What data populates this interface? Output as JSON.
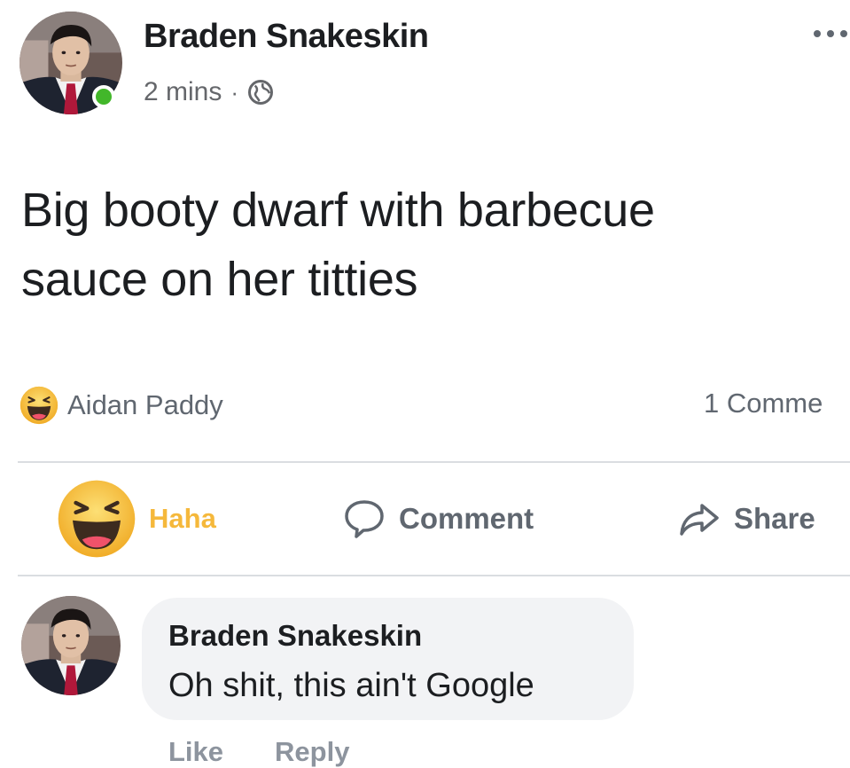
{
  "post": {
    "author": "Braden Snakeskin",
    "time": "2 mins",
    "separator": "·",
    "privacy_icon": "globe-icon",
    "more_icon": "more-options-icon",
    "text": "Big booty dwarf with barbecue\nsauce on her titties"
  },
  "reactions": {
    "icon": "haha-reaction-icon",
    "reactor": "Aidan Paddy",
    "comment_count": "1 Comme"
  },
  "actions": {
    "haha_label": "Haha",
    "comment_label": "Comment",
    "share_label": "Share"
  },
  "comment": {
    "author": "Braden Snakeskin",
    "text": "Oh shit, this ain't Google",
    "like_label": "Like",
    "reply_label": "Reply"
  },
  "colors": {
    "haha_yellow": "#f5b83b",
    "online_green": "#42b72a",
    "secondary_text": "#606770",
    "bubble_bg": "#f2f3f5"
  }
}
